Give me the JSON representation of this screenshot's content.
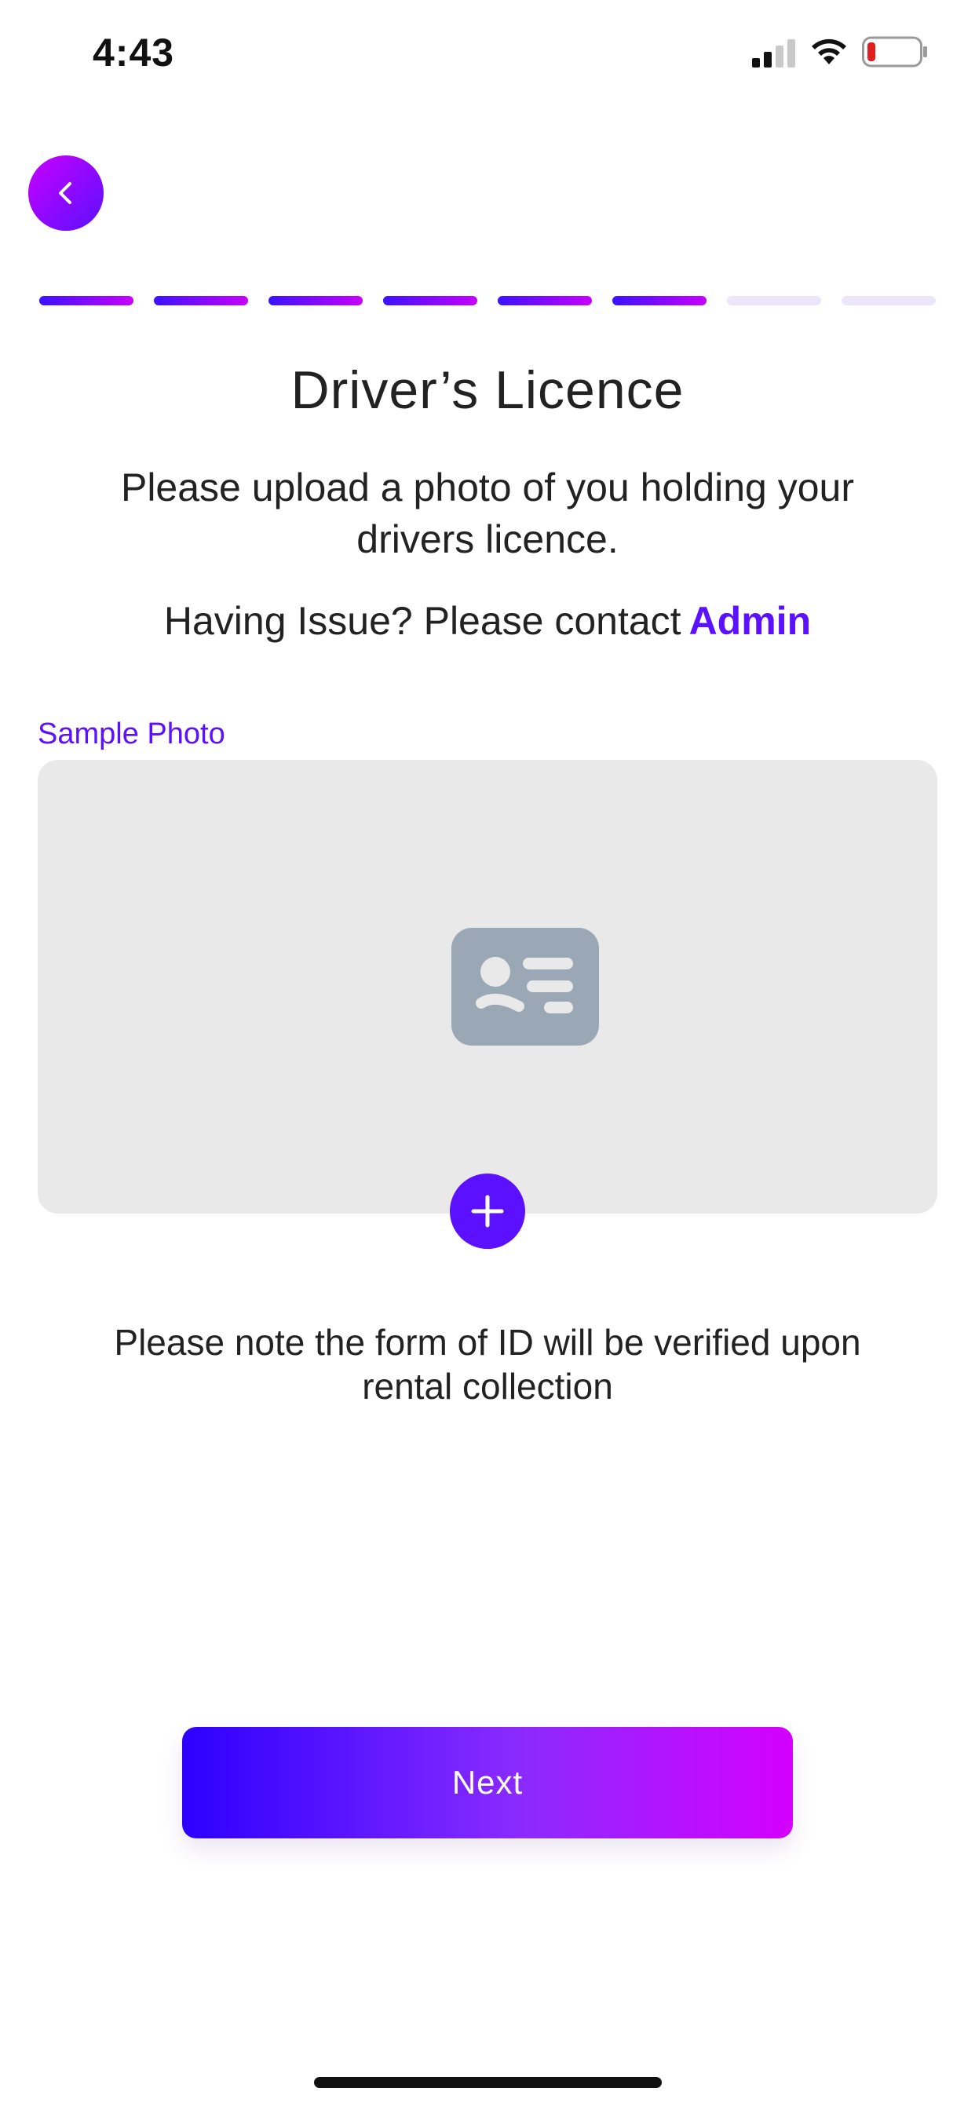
{
  "status_bar": {
    "time": "4:43",
    "signal_icon": "cellular-signal-icon",
    "wifi_icon": "wifi-icon",
    "battery_icon": "battery-low-icon",
    "battery_color": "#e02020"
  },
  "header": {
    "back_icon": "chevron-left-icon"
  },
  "progress": {
    "total_steps": 8,
    "completed_steps": 6,
    "active_gradient": [
      "#3a12ff",
      "#c800ff"
    ],
    "inactive_color": "#ece6fb"
  },
  "content": {
    "title": "Driver’s Licence",
    "subtitle": "Please upload a photo of you holding your drivers licence.",
    "help_text": "Having Issue? Please contact",
    "help_link": "Admin",
    "sample_label": "Sample Photo",
    "card_icon": "id-card-icon",
    "add_icon": "plus-icon",
    "note": "Please note the form of ID will be verified upon rental collection"
  },
  "footer": {
    "next_label": "Next"
  },
  "colors": {
    "accent": "#5b10ff",
    "card_background": "#e9e9e9",
    "id_icon_color": "#9aa7b5"
  }
}
